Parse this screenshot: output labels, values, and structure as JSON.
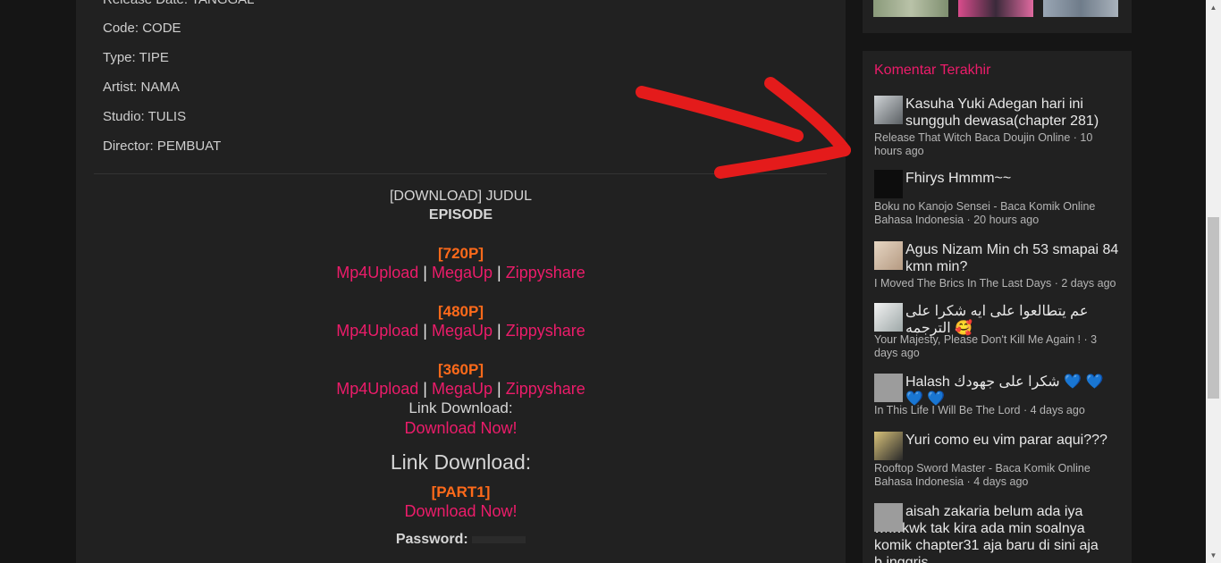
{
  "post": {
    "release_partial": "Release Date: TANGGAL",
    "code": "Code: CODE",
    "type": "Type: TIPE",
    "artist": "Artist: NAMA",
    "studio": "Studio: TULIS",
    "director": "Director: PEMBUAT",
    "download_title": "[DOWNLOAD] JUDUL",
    "episode": "EPISODE",
    "qualities": [
      {
        "label": "[720P]",
        "links": [
          "Mp4Upload",
          "MegaUp",
          "Zippyshare"
        ]
      },
      {
        "label": "[480P]",
        "links": [
          "Mp4Upload",
          "MegaUp",
          "Zippyshare"
        ]
      },
      {
        "label": "[360P]",
        "links": [
          "Mp4Upload",
          "MegaUp",
          "Zippyshare"
        ]
      }
    ],
    "separator": "|",
    "link_download_small": "Link Download:",
    "download_now_1": "Download Now!",
    "link_download_big": "Link Download:",
    "part1": "[PART1]",
    "download_now_2": "Download Now!",
    "password_label": "Password:"
  },
  "sidebar": {
    "title": "Komentar Terakhir",
    "comments": [
      {
        "text": "Kasuha Yuki Adegan hari ini sungguh dewasa(chapter 281)",
        "meta": "Release That Witch Baca Doujin Online · 10 hours ago"
      },
      {
        "text": "Fhirys Hmmm~~",
        "meta": "Boku no Kanojo Sensei - Baca Komik Online Bahasa Indonesia · 20 hours ago"
      },
      {
        "text": "Agus Nizam Min ch 53 smapai 84 kmn min?",
        "meta": "I Moved The Brics In The Last Days  · 2 days ago"
      },
      {
        "text": "عم يتطالعوا على ايه شكرا على الترجمه 🥰",
        "meta": "Your Majesty, Please Don't Kill Me Again !  · 3 days ago"
      },
      {
        "text": "Halash شكرا على جهودك 💙 💙 💙 💙",
        "meta": "In This Life I Will Be The Lord  · 4 days ago"
      },
      {
        "text": "Yuri como eu vim parar aqui???",
        "meta": "Rooftop Sword Master - Baca Komik Online Bahasa Indonesia · 4 days ago"
      },
      {
        "text": "aisah zakaria belum ada iya wkwkwk tak kira ada min soalnya komik chapter31 aja baru di sini aja b.inggris",
        "meta": ""
      }
    ]
  },
  "colors": {
    "accent_pink": "#ec1c6a",
    "accent_orange": "#ff6a1a",
    "annotation_red": "#e41b1b"
  },
  "icons": [
    "scroll-up-arrow-icon",
    "scroll-down-arrow-icon",
    "annotation-arrow-icon"
  ]
}
